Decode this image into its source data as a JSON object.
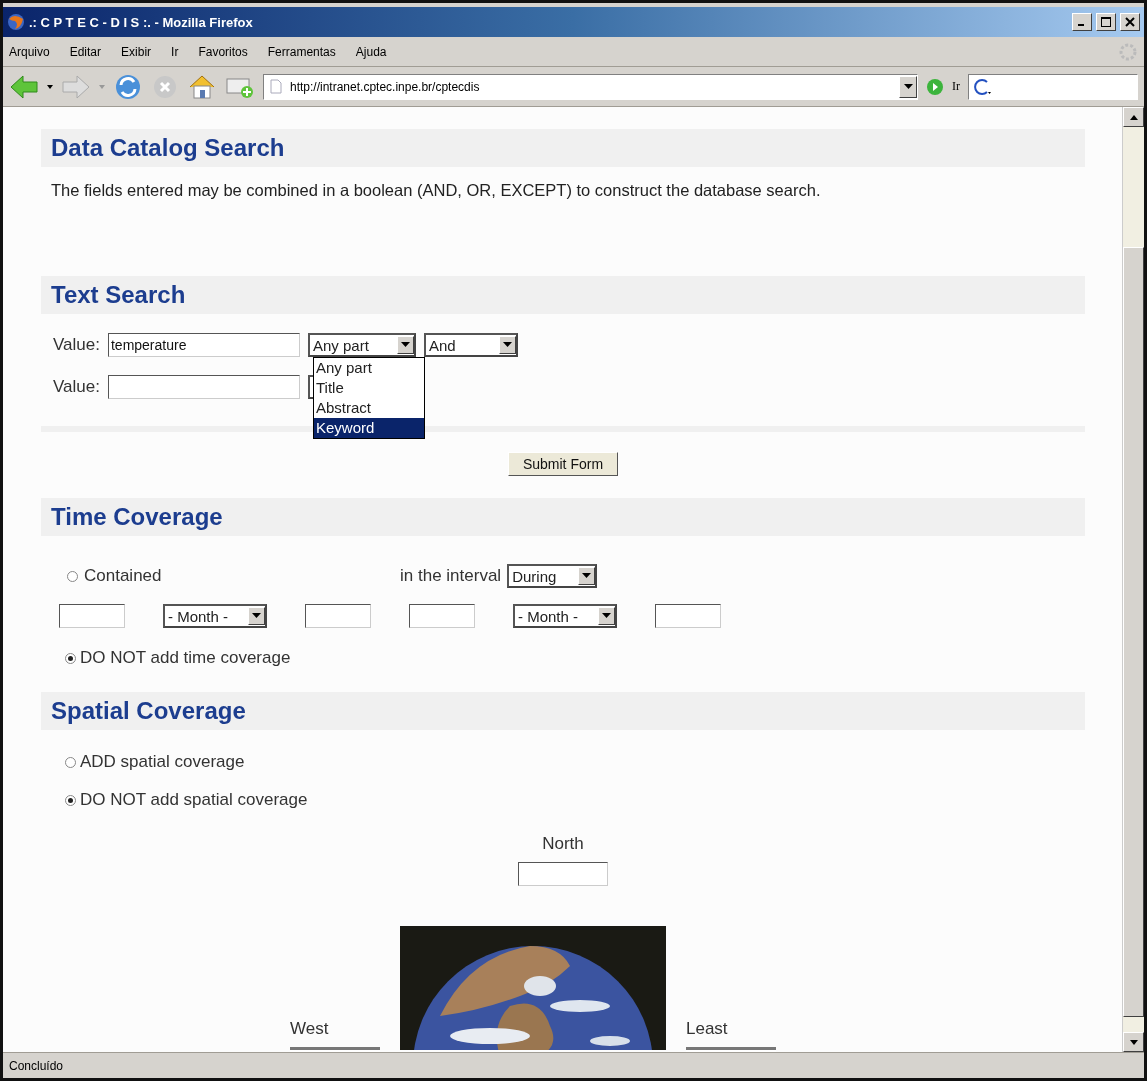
{
  "window": {
    "title": ".: C P T E C - D I S :. - Mozilla Firefox"
  },
  "menu": [
    "Arquivo",
    "Editar",
    "Exibir",
    "Ir",
    "Favoritos",
    "Ferramentas",
    "Ajuda"
  ],
  "toolbar": {
    "address": "http://intranet.cptec.inpe.br/cptecdis",
    "go_label": "Ir"
  },
  "page": {
    "title": "Data Catalog Search",
    "description": "The fields entered may be combined in a boolean (AND, OR, EXCEPT) to construct the database search.",
    "text_search": {
      "title": "Text Search",
      "rows": [
        {
          "label": "Value:",
          "value": "temperature",
          "scope": "Any part",
          "operator": "And"
        },
        {
          "label": "Value:"
        }
      ],
      "open_list": [
        {
          "label": "Any part",
          "selected": false
        },
        {
          "label": "Title",
          "selected": false
        },
        {
          "label": "Abstract",
          "selected": false
        },
        {
          "label": "Keyword",
          "selected": true
        }
      ],
      "submit": "Submit Form"
    },
    "time_coverage": {
      "title": "Time Coverage",
      "contained": {
        "label": "Contained",
        "selected": false
      },
      "interval_label": "in the interval",
      "interval": "During",
      "month_from": "- Month -",
      "month_to": "- Month -",
      "no_time": {
        "label": "DO NOT add time coverage",
        "selected": true
      }
    },
    "spatial_coverage": {
      "title": "Spatial Coverage",
      "options": [
        {
          "label": "ADD spatial coverage",
          "selected": false
        },
        {
          "label": "DO NOT add spatial coverage",
          "selected": true
        }
      ],
      "north": "North",
      "west": "West",
      "east": "Least"
    }
  },
  "status_bar": "Concluído"
}
